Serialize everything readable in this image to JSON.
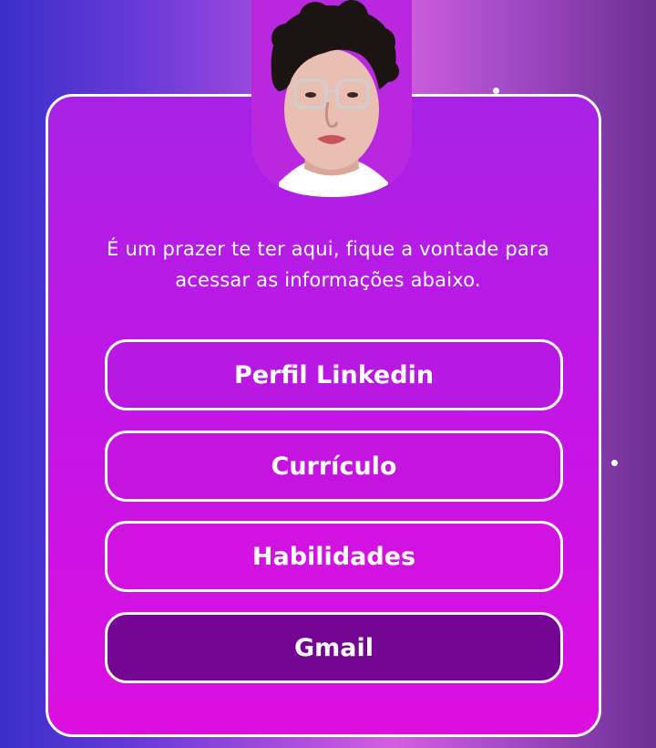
{
  "profile": {
    "avatar_icon": "profile-photo"
  },
  "welcome": {
    "line1": "É um prazer te ter aqui, fique a vontade para",
    "line2": "acessar as informações abaixo."
  },
  "buttons": [
    {
      "label": "Perfil Linkedin"
    },
    {
      "label": "Currículo"
    },
    {
      "label": "Habilidades"
    },
    {
      "label": "Gmail"
    }
  ],
  "colors": {
    "card_border": "#ffffff",
    "button_text": "#ffffff",
    "active_button": "#740492"
  }
}
